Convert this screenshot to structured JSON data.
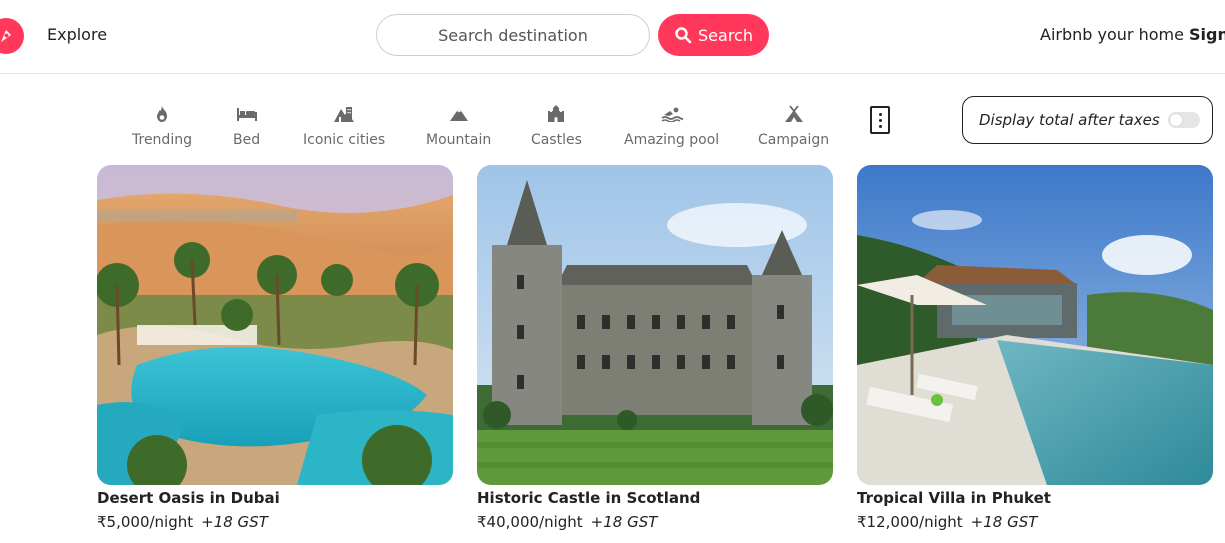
{
  "header": {
    "logo_icon": "compass-logo-icon",
    "explore_label": "Explore",
    "search_placeholder": "Search destination",
    "search_button_label": "Search",
    "host_label": "Airbnb your home",
    "sign_label": "Sign"
  },
  "categories": [
    {
      "label": "Trending",
      "icon": "fire-icon"
    },
    {
      "label": "Bed",
      "icon": "bed-icon"
    },
    {
      "label": "Iconic cities",
      "icon": "city-icon"
    },
    {
      "label": "Mountain",
      "icon": "mountain-icon"
    },
    {
      "label": "Castles",
      "icon": "castle-icon"
    },
    {
      "label": "Amazing pool",
      "icon": "swimmer-icon"
    },
    {
      "label": "Campaign",
      "icon": "tent-icon"
    }
  ],
  "more_icon": "kebab-menu-icon",
  "tax_toggle": {
    "label": "Display total after taxes",
    "enabled": false
  },
  "listings": [
    {
      "title": "Desert Oasis in Dubai",
      "price": "₹5,000/night",
      "gst": "+18 GST"
    },
    {
      "title": "Historic Castle in Scotland",
      "price": "₹40,000/night",
      "gst": "+18 GST"
    },
    {
      "title": "Tropical Villa in Phuket",
      "price": "₹12,000/night",
      "gst": "+18 GST"
    }
  ],
  "colors": {
    "brand": "#ff385c",
    "text": "#222222",
    "muted": "#6a6a6a",
    "border": "#e2e2e2"
  }
}
